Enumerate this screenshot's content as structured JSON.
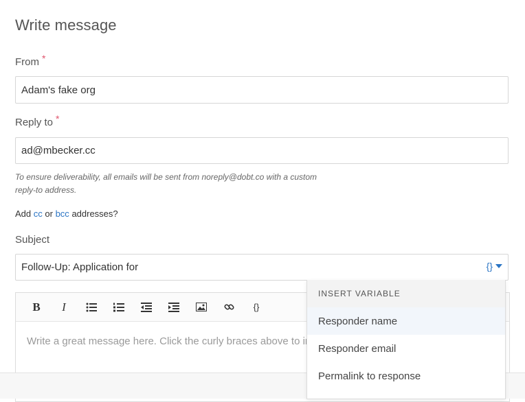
{
  "page": {
    "title": "Write message"
  },
  "from": {
    "label": "From",
    "required_mark": "*",
    "value": "Adam's fake org"
  },
  "reply_to": {
    "label": "Reply to",
    "required_mark": "*",
    "value": "ad@mbecker.cc"
  },
  "hint": {
    "line1": "To ensure deliverability, all emails will be sent from noreply@dobt.co with a custom",
    "line2": "reply-to address."
  },
  "cc_bcc": {
    "prefix": "Add",
    "cc": "cc",
    "or": "or",
    "bcc": "bcc",
    "suffix": "addresses?"
  },
  "subject": {
    "label": "Subject",
    "value": "Follow-Up: Application for",
    "variable_toggle": "{}"
  },
  "editor": {
    "toolbar": [
      {
        "name": "bold-button",
        "glyph": "B",
        "icon": "bold-icon"
      },
      {
        "name": "italic-button",
        "glyph": "I",
        "icon": "italic-icon"
      },
      {
        "name": "bullet-list-button",
        "icon": "bullet-list-icon"
      },
      {
        "name": "numbered-list-button",
        "icon": "numbered-list-icon"
      },
      {
        "name": "outdent-button",
        "icon": "outdent-icon"
      },
      {
        "name": "indent-button",
        "icon": "indent-icon"
      },
      {
        "name": "image-button",
        "icon": "image-icon"
      },
      {
        "name": "link-button",
        "icon": "link-icon"
      },
      {
        "name": "variable-button",
        "glyph": "{}",
        "icon": "curly-braces-icon"
      }
    ],
    "placeholder": "Write a great message here. Click the curly braces above to insert variables."
  },
  "insert_variable_dropdown": {
    "header": "INSERT VARIABLE",
    "items": [
      "Responder name",
      "Responder email",
      "Permalink to response"
    ]
  },
  "colors": {
    "link": "#2a74c4",
    "required": "#e0566e",
    "border": "#d6d6d6"
  }
}
